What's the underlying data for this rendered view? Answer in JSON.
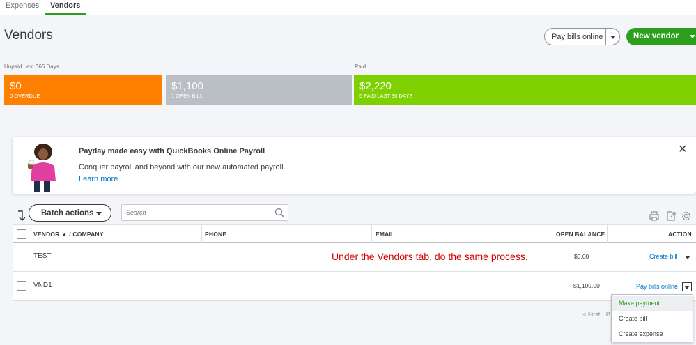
{
  "tabs": [
    {
      "label": "Expenses"
    },
    {
      "label": "Vendors"
    }
  ],
  "page": {
    "title": "Vendors",
    "pay_bills_label": "Pay bills online",
    "new_vendor_label": "New vendor"
  },
  "money_bar": {
    "unpaid_label": "Unpaid Last 365 Days",
    "paid_label": "Paid",
    "segments": [
      {
        "amount": "$0",
        "sub": "0 OVERDUE",
        "color": "#ff8000"
      },
      {
        "amount": "$1,100",
        "sub": "1 OPEN BILL",
        "color": "#babec5"
      },
      {
        "amount": "$2,220",
        "sub": "5 PAID LAST 30 DAYS",
        "color": "#7fd000"
      }
    ]
  },
  "banner": {
    "title": "Payday made easy with QuickBooks Online Payroll",
    "text": "Conquer payroll and beyond with our new automated payroll.",
    "link": "Learn more",
    "close": "✕"
  },
  "toolbar": {
    "batch_label": "Batch actions",
    "search_placeholder": "Search"
  },
  "table": {
    "headers": {
      "vendor": "VENDOR ▲ / COMPANY",
      "phone": "PHONE",
      "email": "EMAIL",
      "balance": "OPEN BALANCE",
      "action": "ACTION"
    },
    "rows": [
      {
        "name": "TEST",
        "balance": "$0.00",
        "action": "Create bill"
      },
      {
        "name": "VND1",
        "balance": "$1,100.00",
        "action": "Pay bills online"
      }
    ]
  },
  "annotation": "Under the Vendors tab, do the same process.",
  "dropdown": {
    "items": [
      "Make payment",
      "Create bill",
      "Create expense"
    ]
  },
  "pager": {
    "first": "< First",
    "prev": "P"
  },
  "colors": {
    "accent": "#2ca01c",
    "link": "#0077c5",
    "annotation": "#d50000"
  }
}
